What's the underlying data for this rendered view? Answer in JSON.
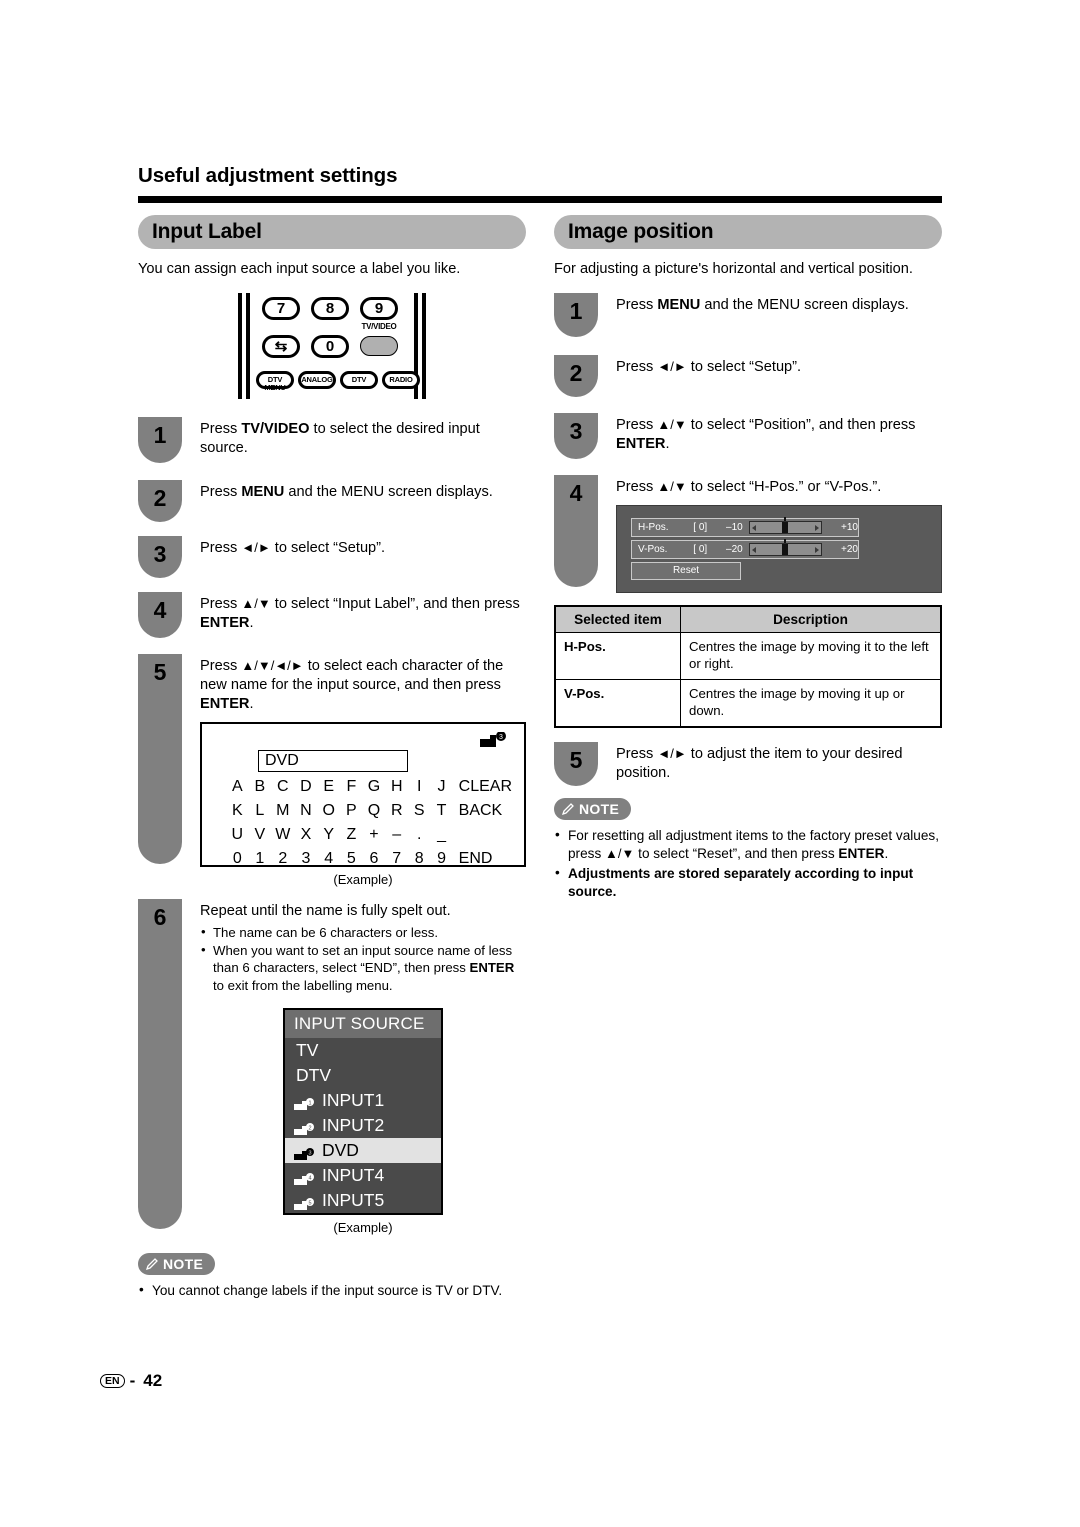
{
  "chapter": {
    "title": "Useful adjustment settings"
  },
  "footer": {
    "lang_mark": "EN",
    "separator": "-",
    "page_number": "42"
  },
  "left_column": {
    "section_title": "Input Label",
    "intro": "You can assign each input source a label you like.",
    "remote": {
      "keys": [
        "7",
        "8",
        "9"
      ],
      "key_flip": "⇆",
      "key_zero": "0",
      "tv_video_label": "TV/VIDEO",
      "bottom_keys": [
        "DTV MENU",
        "ANALOG",
        "DTV",
        "RADIO"
      ],
      "bottom_key_1_line1": "DTV",
      "bottom_key_1_line2": "MENU"
    },
    "steps": [
      {
        "number": "1",
        "text_parts": [
          "Press ",
          "TV/VIDEO",
          " to select the desired input source."
        ],
        "plain": "Press TV/VIDEO to select the desired input source."
      },
      {
        "number": "2",
        "plain": "Press MENU and the MENU screen displays."
      },
      {
        "number": "3",
        "plain": "Press ◄/► to select “Setup”."
      },
      {
        "number": "4",
        "plain": "Press ▲/▼ to select “Input Label”, and then press ENTER."
      },
      {
        "number": "5",
        "plain": "Press ▲/▼/◄/► to select each character of the new name for the input source, and then press ENTER."
      },
      {
        "number": "6",
        "plain": "Repeat until the name is fully spelt out."
      }
    ],
    "step1": {
      "pre": "Press ",
      "bold": "TV/VIDEO",
      "post": " to select the desired input source."
    },
    "step2": {
      "pre": "Press ",
      "bold": "MENU",
      "post": " and the MENU screen displays."
    },
    "step3": {
      "pre": "Press ",
      "arrows": "◄/►",
      "post": " to select “Setup”."
    },
    "step4": {
      "pre": "Press ",
      "arrows": "▲/▼",
      "mid": " to select “Input Label”, and then press ",
      "bold": "ENTER",
      "post": "."
    },
    "step5": {
      "pre": "Press ",
      "arrows": "▲/▼/◄/►",
      "mid": " to select each character of the new name for the input source, and then press ",
      "bold": "ENTER",
      "post": "."
    },
    "step6": {
      "heading": "Repeat until the name is fully spelt out.",
      "bullets": [
        "The name can be 6 characters or less.",
        "When you want to set an input source name of less than 6 characters, select “END”, then press ENTER to exit from the labelling menu."
      ],
      "bullet2_pre": "When you want to set an input source name of less than 6 characters, select “END”, then press ",
      "bullet2_bold": "ENTER",
      "bullet2_post": " to exit from the labelling menu."
    },
    "char_screen": {
      "name_value": "DVD",
      "badge_number": "3",
      "rows": [
        [
          "A",
          "B",
          "C",
          "D",
          "E",
          "F",
          "G",
          "H",
          "I",
          "J",
          "CLEAR"
        ],
        [
          "K",
          "L",
          "M",
          "N",
          "O",
          "P",
          "Q",
          "R",
          "S",
          "T",
          "BACK"
        ],
        [
          "U",
          "V",
          "W",
          "X",
          "Y",
          "Z",
          "+",
          "–",
          ".",
          "_",
          ""
        ],
        [
          "0",
          "1",
          "2",
          "3",
          "4",
          "5",
          "6",
          "7",
          "8",
          "9",
          "END"
        ]
      ],
      "caption": "(Example)"
    },
    "input_source_osd": {
      "title": "INPUT SOURCE",
      "items": [
        {
          "label": "TV",
          "icon": "",
          "selected": false
        },
        {
          "label": "DTV",
          "icon": "",
          "selected": false
        },
        {
          "label": "INPUT1",
          "icon": "1",
          "selected": false
        },
        {
          "label": "INPUT2",
          "icon": "2",
          "selected": false
        },
        {
          "label": "DVD",
          "icon": "3",
          "selected": true
        },
        {
          "label": "INPUT4",
          "icon": "4",
          "selected": false
        },
        {
          "label": "INPUT5",
          "icon": "5",
          "selected": false
        }
      ],
      "caption": "(Example)"
    },
    "note": {
      "badge": "NOTE",
      "items": [
        "You cannot change labels if the input source is TV or DTV."
      ]
    }
  },
  "right_column": {
    "section_title": "Image position",
    "intro": "For adjusting a picture's horizontal and vertical position.",
    "step1": {
      "number": "1",
      "pre": "Press ",
      "bold": "MENU",
      "post": " and the MENU screen displays."
    },
    "step2": {
      "number": "2",
      "pre": "Press ",
      "arrows": "◄/►",
      "post": " to select “Setup”."
    },
    "step3": {
      "number": "3",
      "pre": "Press ",
      "arrows": "▲/▼",
      "mid": " to select “Position”, and then press ",
      "bold": "ENTER",
      "post": "."
    },
    "step4": {
      "number": "4",
      "pre": "Press ",
      "arrows": "▲/▼",
      "post": " to select “H-Pos.” or “V-Pos.”."
    },
    "step5": {
      "number": "5",
      "pre": "Press ",
      "arrows": "◄/►",
      "post": " to adjust the item to your desired position."
    },
    "position_osd": {
      "rows": [
        {
          "name": "H-Pos.",
          "value": "[ 0]",
          "min": "–10",
          "max": "+10"
        },
        {
          "name": "V-Pos.",
          "value": "[ 0]",
          "min": "–20",
          "max": "+20"
        }
      ],
      "reset_label": "Reset"
    },
    "table": {
      "headers": [
        "Selected item",
        "Description"
      ],
      "rows": [
        {
          "item": "H-Pos.",
          "description": "Centres the image by moving it to the left or right."
        },
        {
          "item": "V-Pos.",
          "description": "Centres the image by moving it up or down."
        }
      ]
    },
    "note": {
      "badge": "NOTE",
      "items": [
        "For resetting all adjustment items to the factory preset values, press ▲/▼ to select “Reset”, and then press ENTER.",
        "Adjustments are stored separately according to input source."
      ],
      "item1_pre": "For resetting all adjustment items to the factory preset values, press ",
      "item1_arrows": "▲/▼",
      "item1_mid": " to select “Reset”, and then press ",
      "item1_bold": "ENTER",
      "item1_post": ".",
      "item2_bold": "Adjustments are stored separately according to input source."
    }
  }
}
